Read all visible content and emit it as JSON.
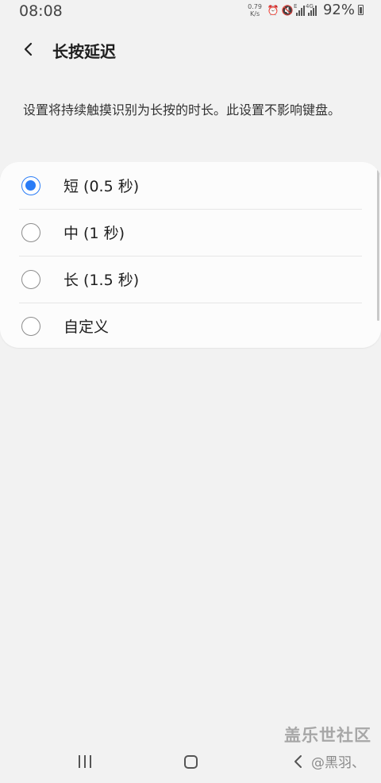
{
  "status_bar": {
    "time": "08:08",
    "net_speed_value": "0.79",
    "net_speed_unit": "K/s",
    "alarm_icon": "alarm-icon",
    "mute_icon": "mute-icon",
    "signal_1_tag": "E",
    "signal_2_tag": "4G",
    "battery": "92%"
  },
  "header": {
    "title": "长按延迟",
    "back_icon": "back-arrow-icon"
  },
  "description": "设置将持续触摸识别为长按的时长。此设置不影响键盘。",
  "options": [
    {
      "label": "短 (0.5 秒)",
      "checked": true
    },
    {
      "label": "中 (1 秒)",
      "checked": false
    },
    {
      "label": "长 (1.5 秒)",
      "checked": false
    },
    {
      "label": "自定义",
      "checked": false
    }
  ],
  "watermark": {
    "main": "盖乐世社区",
    "sub": "@黑羽、"
  },
  "nav_bar": {
    "recents_icon": "recents-icon",
    "home_icon": "home-icon",
    "back_icon": "back-icon"
  },
  "colors": {
    "background": "#f2f2f2",
    "accent": "#2a7cf6",
    "card": "#fcfcfc"
  }
}
